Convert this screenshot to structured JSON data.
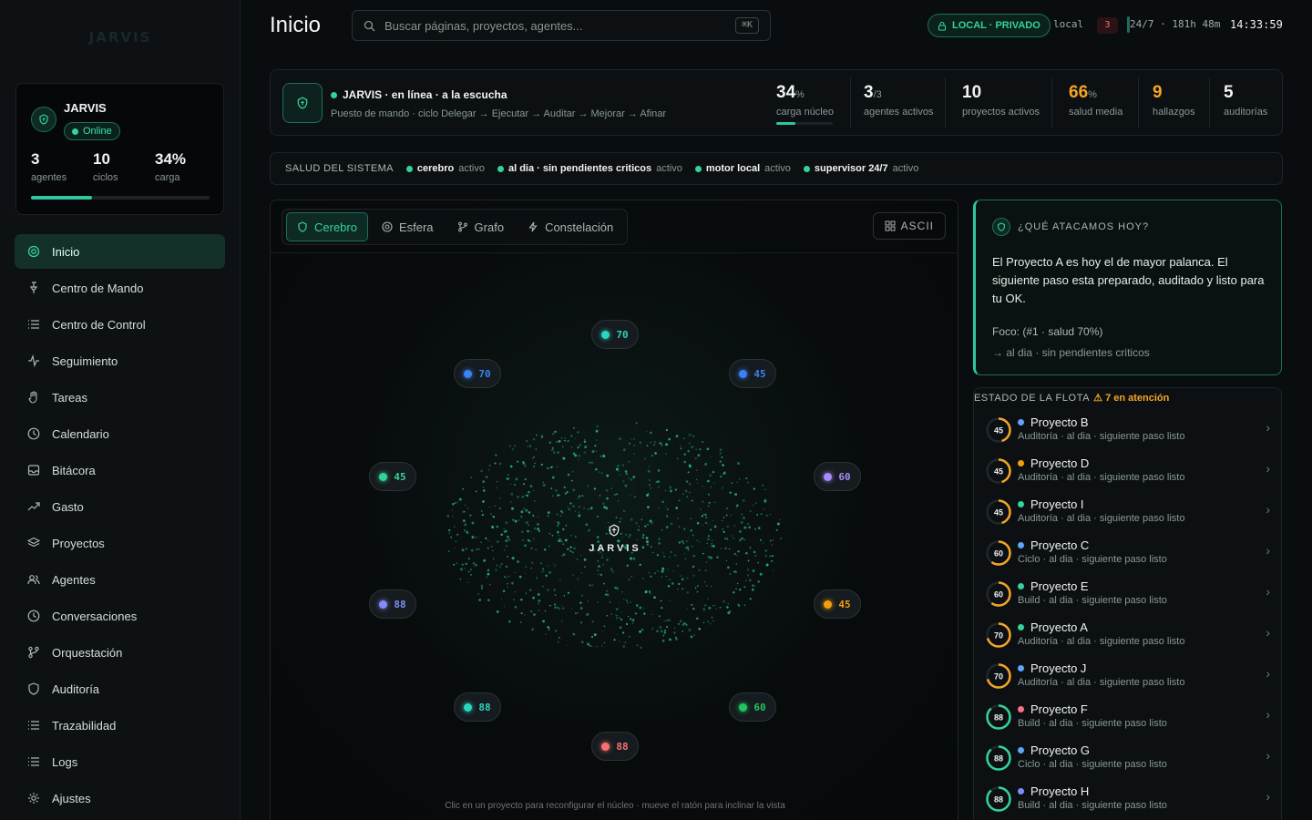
{
  "app": {
    "logo": "JARVIS",
    "page_title": "Inicio"
  },
  "sidebar": {
    "card": {
      "name": "JARVIS",
      "status": "Online",
      "load_pct": 0.34,
      "stats": [
        {
          "value": "3",
          "label": "agentes"
        },
        {
          "value": "10",
          "label": "ciclos"
        },
        {
          "value": "34%",
          "label": "carga"
        }
      ]
    },
    "items": [
      {
        "label": "Inicio",
        "icon": "target-icon",
        "active": true
      },
      {
        "label": "Centro de Mando",
        "icon": "pin-icon"
      },
      {
        "label": "Centro de Control",
        "icon": "list-icon"
      },
      {
        "label": "Seguimiento",
        "icon": "activity-icon"
      },
      {
        "label": "Tareas",
        "icon": "hand-icon"
      },
      {
        "label": "Calendario",
        "icon": "clock-icon"
      },
      {
        "label": "Bitácora",
        "icon": "inbox-icon"
      },
      {
        "label": "Gasto",
        "icon": "trend-icon"
      },
      {
        "label": "Proyectos",
        "icon": "layers-icon"
      },
      {
        "label": "Agentes",
        "icon": "users-icon"
      },
      {
        "label": "Conversaciones",
        "icon": "clock-icon"
      },
      {
        "label": "Orquestación",
        "icon": "branch-icon"
      },
      {
        "label": "Auditoría",
        "icon": "shield-icon"
      },
      {
        "label": "Trazabilidad",
        "icon": "list-icon"
      },
      {
        "label": "Logs",
        "icon": "list-icon"
      },
      {
        "label": "Ajustes",
        "icon": "gear-icon"
      }
    ]
  },
  "topbar": {
    "search_placeholder": "Buscar páginas, proyectos, agentes...",
    "shortcut": "⌘K",
    "mode_badge": "LOCAL · PRIVADO",
    "host": "local",
    "alert_count": "3",
    "uptime": "24/7 · 181h 48m",
    "clock": "14:33:59"
  },
  "status": {
    "title": "JARVIS · en línea · a la escucha",
    "subtitle": "Puesto de mando · ciclo Delegar → Ejecutar → Auditar → Mejorar → Afinar",
    "metrics": [
      {
        "value": "34",
        "unit": "%",
        "label": "carga núcleo",
        "bar": 0.34
      },
      {
        "value": "3",
        "unit": "/3",
        "label": "agentes activos"
      },
      {
        "value": "10",
        "unit": "",
        "label": "proyectos activos"
      },
      {
        "value": "66",
        "unit": "%",
        "label": "salud media",
        "warn": true
      },
      {
        "value": "9",
        "unit": "",
        "label": "hallazgos",
        "warn": true
      },
      {
        "value": "5",
        "unit": "",
        "label": "auditorías"
      }
    ]
  },
  "health": {
    "label": "SALUD DEL SISTEMA",
    "items": [
      {
        "name": "cerebro",
        "state": "activo"
      },
      {
        "name": "al dia · sin pendientes criticos",
        "state": "activo"
      },
      {
        "name": "motor local",
        "state": "activo"
      },
      {
        "name": "supervisor 24/7",
        "state": "activo"
      }
    ]
  },
  "viz": {
    "tabs": [
      {
        "label": "Cerebro",
        "icon": "brain-icon",
        "active": true
      },
      {
        "label": "Esfera",
        "icon": "sphere-icon"
      },
      {
        "label": "Grafo",
        "icon": "graph-icon"
      },
      {
        "label": "Constelación",
        "icon": "bolt-icon"
      }
    ],
    "ascii_label": "ASCII",
    "core_label": "JARVIS",
    "footer": "Clic en un proyecto para reconfigurar el núcleo · mueve el ratón para inclinar la vista",
    "nodes": [
      {
        "value": "70",
        "color": "#2dd4bf"
      },
      {
        "value": "45",
        "color": "#3b82f6"
      },
      {
        "value": "60",
        "color": "#a78bfa"
      },
      {
        "value": "45",
        "color": "#f59e0b"
      },
      {
        "value": "60",
        "color": "#22c55e"
      },
      {
        "value": "88",
        "color": "#f87171"
      },
      {
        "value": "88",
        "color": "#2dd4bf"
      },
      {
        "value": "88",
        "color": "#818cf8"
      },
      {
        "value": "45",
        "color": "#34d399"
      },
      {
        "value": "70",
        "color": "#3b82f6"
      }
    ]
  },
  "ask": {
    "title": "¿QUÉ ATACAMOS HOY?",
    "body": "El Proyecto A es hoy el de mayor palanca. El siguiente paso esta preparado, auditado y listo para tu OK.",
    "focus": "Foco: (#1 · salud 70%)",
    "sub": "→ al dia · sin pendientes criticos"
  },
  "fleet": {
    "title": "ESTADO DE LA FLOTA",
    "attention": "7 en atención",
    "rows": [
      {
        "score": "45",
        "name": "Proyecto B",
        "detail": "Auditoría · al dia · siguiente paso listo",
        "dot": "#60a5fa",
        "ring": "#f5a524"
      },
      {
        "score": "45",
        "name": "Proyecto D",
        "detail": "Auditoría · al dia · siguiente paso listo",
        "dot": "#f59e0b",
        "ring": "#f5a524"
      },
      {
        "score": "45",
        "name": "Proyecto I",
        "detail": "Auditoría · al dia · siguiente paso listo",
        "dot": "#34d399",
        "ring": "#f5a524"
      },
      {
        "score": "60",
        "name": "Proyecto C",
        "detail": "Ciclo · al dia · siguiente paso listo",
        "dot": "#60a5fa",
        "ring": "#f5a524"
      },
      {
        "score": "60",
        "name": "Proyecto E",
        "detail": "Build · al dia · siguiente paso listo",
        "dot": "#34d399",
        "ring": "#f5a524"
      },
      {
        "score": "70",
        "name": "Proyecto A",
        "detail": "Auditoría · al dia · siguiente paso listo",
        "dot": "#34d399",
        "ring": "#f5a524"
      },
      {
        "score": "70",
        "name": "Proyecto J",
        "detail": "Auditoría · al dia · siguiente paso listo",
        "dot": "#60a5fa",
        "ring": "#f5a524"
      },
      {
        "score": "88",
        "name": "Proyecto F",
        "detail": "Build · al dia · siguiente paso listo",
        "dot": "#fb7185",
        "ring": "#34d399"
      },
      {
        "score": "88",
        "name": "Proyecto G",
        "detail": "Ciclo · al dia · siguiente paso listo",
        "dot": "#60a5fa",
        "ring": "#34d399"
      },
      {
        "score": "88",
        "name": "Proyecto H",
        "detail": "Build · al dia · siguiente paso listo",
        "dot": "#818cf8",
        "ring": "#34d399"
      }
    ]
  }
}
